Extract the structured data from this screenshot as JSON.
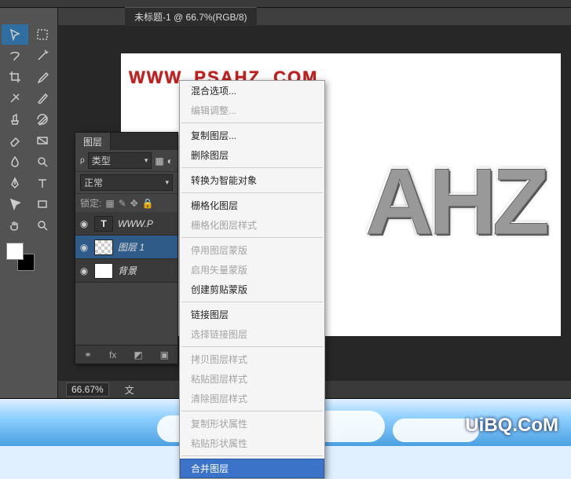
{
  "tab": {
    "title": "未标题-1 @ 66.7%(RGB/8)"
  },
  "canvas": {
    "watermark": "WWW. PSAHZ. COM",
    "big_text": "AHZ"
  },
  "statusbar": {
    "zoom": "66.67%",
    "label": "文"
  },
  "layers": {
    "tab": "图层",
    "kind_label": "类型",
    "blend": "正常",
    "lock_label": "锁定:",
    "items": [
      {
        "name": "WWW.P",
        "kind": "text"
      },
      {
        "name": "图层 1",
        "kind": "raster"
      },
      {
        "name": "背景",
        "kind": "bg"
      }
    ]
  },
  "ctx": {
    "items": [
      {
        "t": "混合选项...",
        "d": false
      },
      {
        "t": "编辑调整...",
        "d": true
      },
      {
        "sep": true
      },
      {
        "t": "复制图层...",
        "d": false
      },
      {
        "t": "删除图层",
        "d": false
      },
      {
        "sep": true
      },
      {
        "t": "转换为智能对象",
        "d": false
      },
      {
        "sep": true
      },
      {
        "t": "栅格化图层",
        "d": false
      },
      {
        "t": "栅格化图层样式",
        "d": true
      },
      {
        "sep": true
      },
      {
        "t": "停用图层蒙版",
        "d": true
      },
      {
        "t": "启用矢量蒙版",
        "d": true
      },
      {
        "t": "创建剪贴蒙版",
        "d": false
      },
      {
        "sep": true
      },
      {
        "t": "链接图层",
        "d": false
      },
      {
        "t": "选择链接图层",
        "d": true
      },
      {
        "sep": true
      },
      {
        "t": "拷贝图层样式",
        "d": true
      },
      {
        "t": "粘贴图层样式",
        "d": true
      },
      {
        "t": "清除图层样式",
        "d": true
      },
      {
        "sep": true
      },
      {
        "t": "复制形状属性",
        "d": true
      },
      {
        "t": "粘贴形状属性",
        "d": true
      },
      {
        "sep": true
      },
      {
        "t": "合并图层",
        "d": false,
        "hover": true
      }
    ]
  },
  "brand": "UiBQ.CoM"
}
